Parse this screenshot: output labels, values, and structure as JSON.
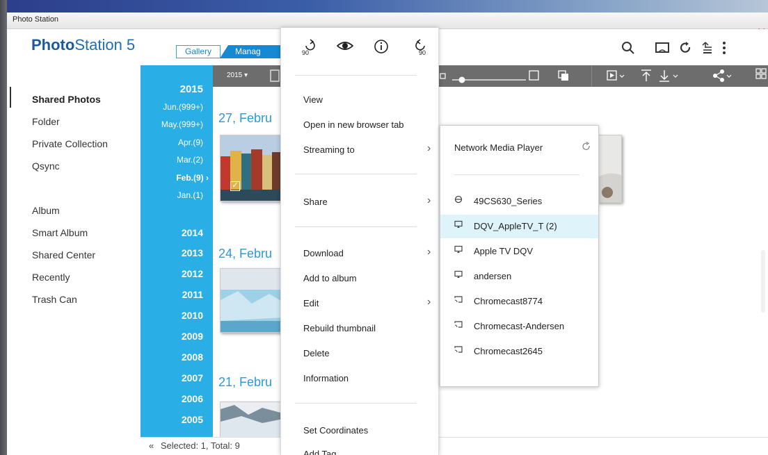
{
  "window": {
    "title": "Photo Station",
    "controls": {
      "minimize": "—",
      "maximize": "+",
      "close": "✕"
    }
  },
  "header": {
    "logo_bold": "Photo",
    "logo_rest": "Station 5",
    "tab_gallery": "Gallery",
    "tab_manage": "Manag",
    "icons": [
      "search-icon",
      "cast-icon",
      "refresh-icon",
      "upload-queue-icon",
      "more-vert-icon"
    ]
  },
  "sidebar": {
    "items": [
      "Shared Photos",
      "Folder",
      "Private Collection",
      "Qsync",
      "Album",
      "Smart Album",
      "Shared Center",
      "Recently",
      "Trash Can"
    ],
    "active_index": 0
  },
  "timeline": {
    "year_2015": "2015",
    "months": [
      "Jun.(999+)",
      "May.(999+)",
      "Apr.(9)",
      "Mar.(2)",
      "Feb.(9) ›",
      "Jan.(1)"
    ],
    "years": [
      "2014",
      "2013",
      "2012",
      "2011",
      "2010",
      "2009",
      "2008",
      "2007",
      "2006",
      "2005"
    ]
  },
  "toolbar": {
    "timeline_btn": "2015 ▾",
    "icons": [
      "timeline-icon",
      "layout-icon",
      "small-size-icon",
      "size-slider",
      "large-size-icon",
      "copy-icon",
      "slideshow-icon",
      "upload-icon",
      "download-icon",
      "share-icon",
      "view-mode-icon"
    ]
  },
  "content": {
    "groups": [
      "27, Febru",
      "24, Febru",
      "21, Febru"
    ]
  },
  "status": {
    "collapse": "«",
    "text": "Selected: 1, Total: 9"
  },
  "context_menu": {
    "top_icons": {
      "rotate_left": "90",
      "rotate_right": "90"
    },
    "items": {
      "view": "View",
      "open_new_tab": "Open in new browser tab",
      "streaming_to": "Streaming to",
      "share": "Share",
      "download": "Download",
      "add_to_album": "Add to album",
      "edit": "Edit",
      "rebuild_thumbnail": "Rebuild thumbnail",
      "delete": "Delete",
      "information": "Information",
      "set_coordinates": "Set Coordinates",
      "add_tag": "Add Tag"
    },
    "arrow": "›"
  },
  "streaming_submenu": {
    "title": "Network Media Player",
    "devices": [
      {
        "name": "49CS630_Series",
        "icon": "dlna-icon"
      },
      {
        "name": "DQV_AppleTV_T (2)",
        "icon": "airplay-icon"
      },
      {
        "name": "Apple TV DQV",
        "icon": "airplay-icon"
      },
      {
        "name": "andersen",
        "icon": "airplay-icon"
      },
      {
        "name": "Chromecast8774",
        "icon": "chromecast-icon"
      },
      {
        "name": "Chromecast-Andersen",
        "icon": "chromecast-icon"
      },
      {
        "name": "Chromecast2645",
        "icon": "chromecast-icon"
      }
    ],
    "highlighted_index": 1,
    "highlight_color": "#dff3fb"
  },
  "colors": {
    "accent": "#29aee6",
    "brand": "#1d6fb3",
    "close": "#e02020",
    "toolbar": "#6d6d6d"
  }
}
